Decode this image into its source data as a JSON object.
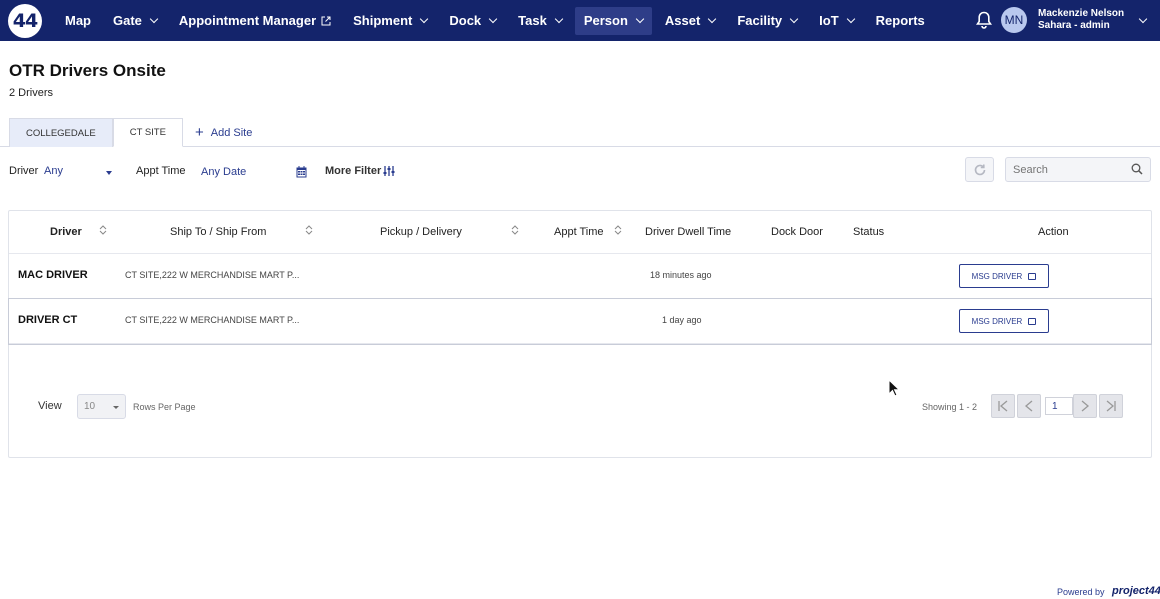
{
  "nav": {
    "logo": "44",
    "items": [
      {
        "label": "Map",
        "chevron": false,
        "external": false
      },
      {
        "label": "Gate",
        "chevron": true,
        "external": false
      },
      {
        "label": "Appointment Manager",
        "chevron": false,
        "external": true
      },
      {
        "label": "Shipment",
        "chevron": true,
        "external": false
      },
      {
        "label": "Dock",
        "chevron": true,
        "external": false
      },
      {
        "label": "Task",
        "chevron": true,
        "external": false
      },
      {
        "label": "Person",
        "chevron": true,
        "external": false,
        "active": true
      },
      {
        "label": "Asset",
        "chevron": true,
        "external": false
      },
      {
        "label": "Facility",
        "chevron": true,
        "external": false
      },
      {
        "label": "IoT",
        "chevron": true,
        "external": false
      },
      {
        "label": "Reports",
        "chevron": false,
        "external": false
      }
    ],
    "user": {
      "initials": "MN",
      "name": "Mackenzie Nelson",
      "role": "Sahara - admin"
    }
  },
  "page": {
    "title": "OTR Drivers Onsite",
    "subtitle": "2 Drivers"
  },
  "tabs": [
    {
      "label": "COLLEGEDALE",
      "active": false
    },
    {
      "label": "CT SITE",
      "active": true
    }
  ],
  "add_site": "Add Site",
  "filters": {
    "driver_label": "Driver",
    "driver_value": "Any",
    "appt_label": "Appt Time",
    "appt_value": "Any Date",
    "more_filter": "More Filter",
    "search_placeholder": "Search"
  },
  "table": {
    "headers": [
      "Driver",
      "Ship To / Ship From",
      "Pickup / Delivery",
      "Appt Time",
      "Driver Dwell Time",
      "Dock Door",
      "Status",
      "Action"
    ],
    "rows": [
      {
        "driver": "MAC DRIVER",
        "ship": "CT SITE,222 W MERCHANDISE MART P...",
        "dwell": "18 minutes ago",
        "action": "MSG DRIVER"
      },
      {
        "driver": "DRIVER CT",
        "ship": "CT SITE,222 W MERCHANDISE MART P...",
        "dwell": "1 day ago",
        "action": "MSG DRIVER"
      }
    ]
  },
  "pagination": {
    "view_label": "View",
    "rows_per_page_value": "10",
    "rows_per_page_label": "Rows Per Page",
    "showing": "Showing 1 - 2",
    "page": "1"
  },
  "footer": {
    "powered": "Powered by",
    "brand": "project44"
  },
  "colors": {
    "nav_bg": "#14246b",
    "accent": "#2a3c8f",
    "tab_inactive": "#e7ecf9"
  },
  "icons": [
    "bell-icon",
    "external-link-icon",
    "calendar-icon",
    "filter-sliders-icon",
    "refresh-icon",
    "search-icon",
    "sort-icon",
    "chat-icon",
    "first-page-icon",
    "prev-page-icon",
    "next-page-icon",
    "last-page-icon",
    "plus-icon"
  ]
}
